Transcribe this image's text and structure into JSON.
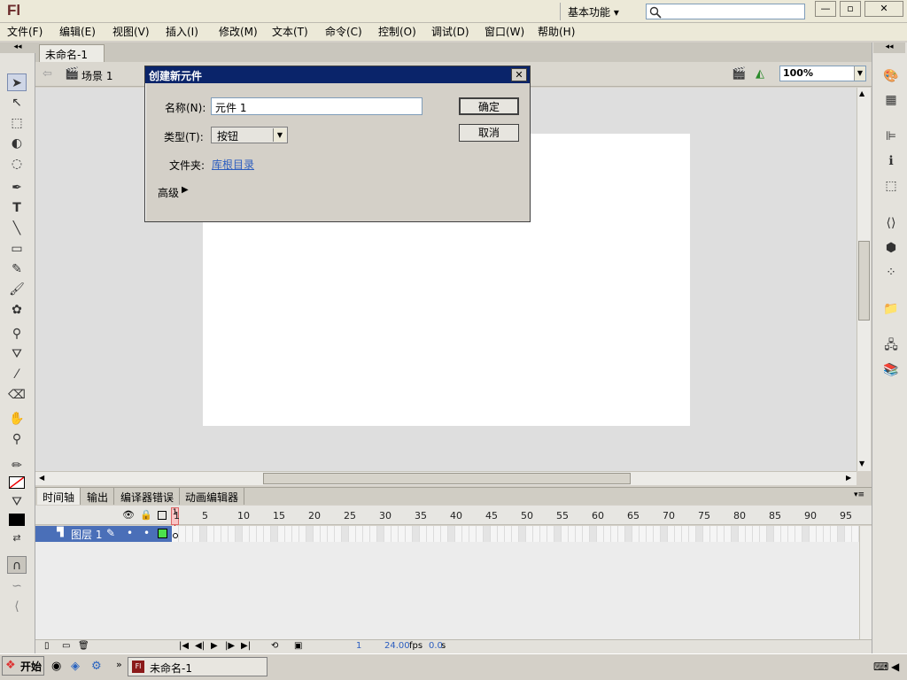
{
  "app": {
    "logo": "Fl",
    "workspace": "基本功能",
    "search_placeholder": ""
  },
  "window_buttons": [
    "—",
    "▫",
    "✕"
  ],
  "menu": [
    "文件(F)",
    "编辑(E)",
    "视图(V)",
    "插入(I)",
    "修改(M)",
    "文本(T)",
    "命令(C)",
    "控制(O)",
    "调试(D)",
    "窗口(W)",
    "帮助(H)"
  ],
  "document": {
    "tab": "未命名-1",
    "tab_close": "×",
    "scene": "场景 1",
    "zoom": "100%"
  },
  "dialog": {
    "title": "创建新元件",
    "name_label": "名称(N):",
    "name_value": "元件 1",
    "type_label": "类型(T):",
    "type_value": "按钮",
    "folder_label": "文件夹:",
    "folder_value": "库根目录",
    "advanced_label": "高级",
    "ok_label": "确定",
    "cancel_label": "取消"
  },
  "timeline": {
    "tabs": [
      "时间轴",
      "输出",
      "编译器错误",
      "动画编辑器"
    ],
    "layer_name": "图层 1",
    "frame_numbers": [
      "1",
      "5",
      "10",
      "15",
      "20",
      "25",
      "30",
      "35",
      "40",
      "45",
      "50",
      "55",
      "60",
      "65",
      "70",
      "75",
      "80",
      "85",
      "90",
      "95"
    ],
    "current_frame": "1",
    "fps": "24.00",
    "fps_unit": "fps",
    "time": "0.0",
    "time_unit": "s"
  },
  "taskbar": {
    "start_label": "开始",
    "task_label": "未命名-1"
  }
}
